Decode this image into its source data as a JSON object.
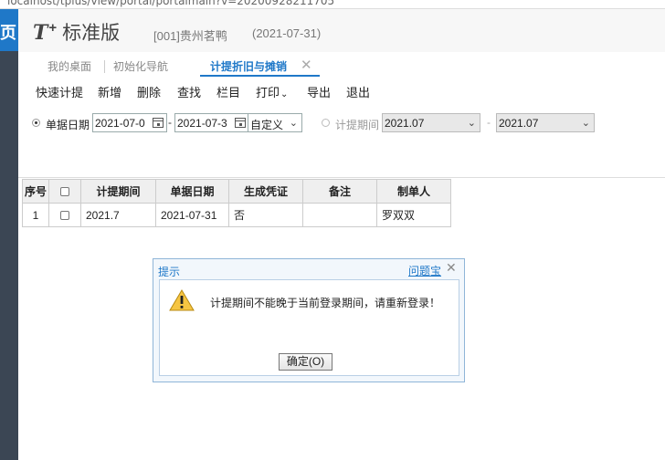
{
  "browser": {
    "address": "localhost/tplus/view/portal/portalmain?v=20200928211705"
  },
  "sidebar": {
    "top_label": "页"
  },
  "header": {
    "logo_letter": "T",
    "logo_plus": "+",
    "edition": "标准版",
    "company": "[001]贵州茗鸭",
    "date": "(2021-07-31)"
  },
  "tabs": [
    {
      "label": "我的桌面"
    },
    {
      "label": "初始化导航"
    },
    {
      "label": "计提折旧与摊销"
    }
  ],
  "toolbar": {
    "items": [
      "快速计提",
      "新增",
      "删除",
      "查找",
      "栏目",
      "打印",
      "导出",
      "退出"
    ]
  },
  "filter": {
    "date_label": "单据日期",
    "date_from": "2021-07-0",
    "date_to": "2021-07-3",
    "range_select": "自定义",
    "period_label": "计提期间",
    "period_from": "2021.07",
    "period_to": "2021.07",
    "dash": "-"
  },
  "table": {
    "headers": [
      "序号",
      "",
      "计提期间",
      "单据日期",
      "生成凭证",
      "备注",
      "制单人"
    ],
    "rows": [
      {
        "seq": "1",
        "period": "2021.7",
        "date": "2021-07-31",
        "voucher": "否",
        "note": "",
        "maker": "罗双双"
      }
    ]
  },
  "dialog": {
    "title": "提示",
    "link": "问题宝",
    "message": "计提期间不能晚于当前登录期间，请重新登录！",
    "ok_label": "确定(O)"
  }
}
